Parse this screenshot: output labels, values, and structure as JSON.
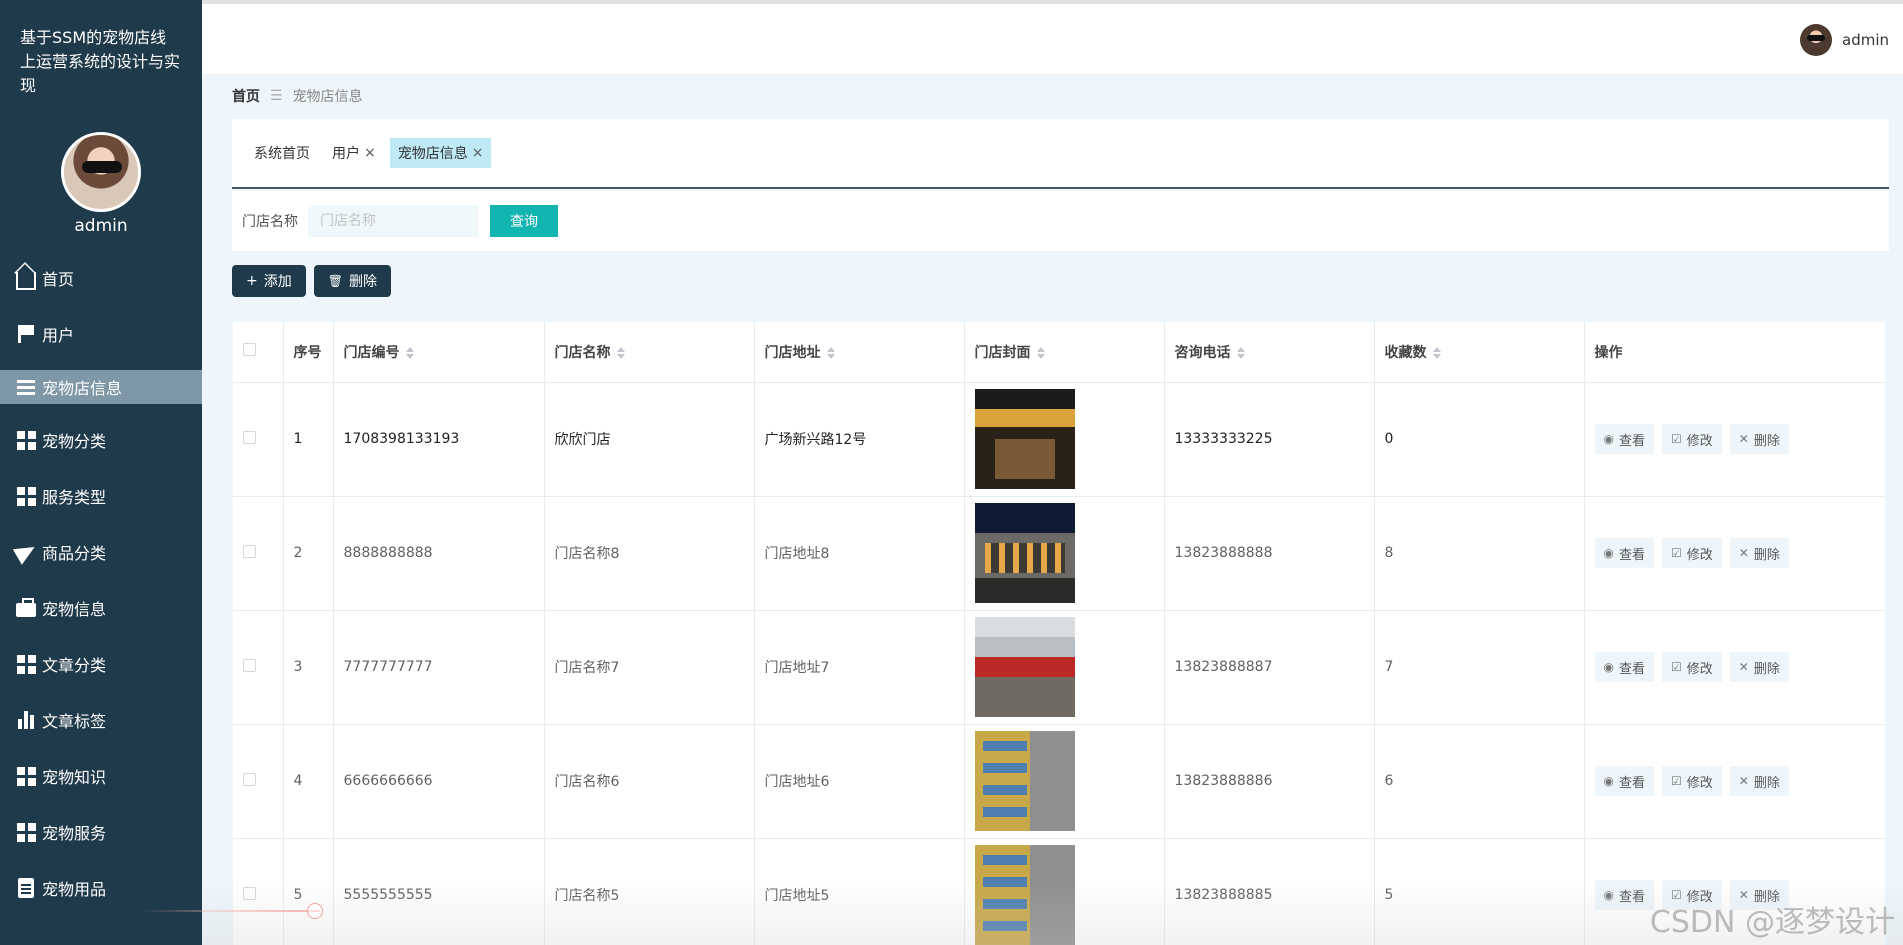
{
  "app": {
    "title": "基于SSM的宠物店线上运营系统的设计与实现"
  },
  "sidebar": {
    "username": "admin",
    "items": [
      {
        "label": "首页",
        "icon": "home-icon"
      },
      {
        "label": "用户",
        "icon": "flag-icon"
      },
      {
        "label": "宠物店信息",
        "icon": "list-icon",
        "active": true
      },
      {
        "label": "宠物分类",
        "icon": "grid-icon"
      },
      {
        "label": "服务类型",
        "icon": "grid-icon"
      },
      {
        "label": "商品分类",
        "icon": "send-icon"
      },
      {
        "label": "宠物信息",
        "icon": "briefcase-icon"
      },
      {
        "label": "文章分类",
        "icon": "grid-icon"
      },
      {
        "label": "文章标签",
        "icon": "bar-chart-icon"
      },
      {
        "label": "宠物知识",
        "icon": "grid-icon"
      },
      {
        "label": "宠物服务",
        "icon": "grid-icon"
      },
      {
        "label": "宠物用品",
        "icon": "document-icon"
      }
    ]
  },
  "header": {
    "username": "admin"
  },
  "breadcrumb": {
    "home": "首页",
    "separator": "☰",
    "current": "宠物店信息"
  },
  "tabs": [
    {
      "label": "系统首页",
      "closable": false
    },
    {
      "label": "用户",
      "closable": true
    },
    {
      "label": "宠物店信息",
      "closable": true,
      "active": true
    }
  ],
  "tab_close": "×",
  "search": {
    "label": "门店名称",
    "placeholder": "门店名称",
    "button": "查询"
  },
  "toolbar": {
    "add_label": "添加",
    "add_icon": "+",
    "delete_label": "删除",
    "delete_icon": "🗑"
  },
  "table": {
    "columns": [
      "序号",
      "门店编号",
      "门店名称",
      "门店地址",
      "门店封面",
      "咨询电话",
      "收藏数",
      "操作"
    ],
    "rows": [
      {
        "idx": "1",
        "code": "1708398133193",
        "name": "欣欣门店",
        "address": "广场新兴路12号",
        "phone": "13333333225",
        "favorites": "0"
      },
      {
        "idx": "2",
        "code": "8888888888",
        "name": "门店名称8",
        "address": "门店地址8",
        "phone": "13823888888",
        "favorites": "8"
      },
      {
        "idx": "3",
        "code": "7777777777",
        "name": "门店名称7",
        "address": "门店地址7",
        "phone": "13823888887",
        "favorites": "7"
      },
      {
        "idx": "4",
        "code": "6666666666",
        "name": "门店名称6",
        "address": "门店地址6",
        "phone": "13823888886",
        "favorites": "6"
      },
      {
        "idx": "5",
        "code": "5555555555",
        "name": "门店名称5",
        "address": "门店地址5",
        "phone": "13823888885",
        "favorites": "5"
      }
    ],
    "actions": {
      "view": "查看",
      "edit": "修改",
      "delete": "删除",
      "view_icon": "◉",
      "edit_icon": "☑",
      "delete_icon": "✕"
    }
  },
  "watermark": "CSDN @逐梦设计",
  "colors": {
    "sidebar": "#1f3a4a",
    "accent": "#13b5b1",
    "active_tab": "#bfeaf5",
    "active_menu": "#7f98a8"
  }
}
